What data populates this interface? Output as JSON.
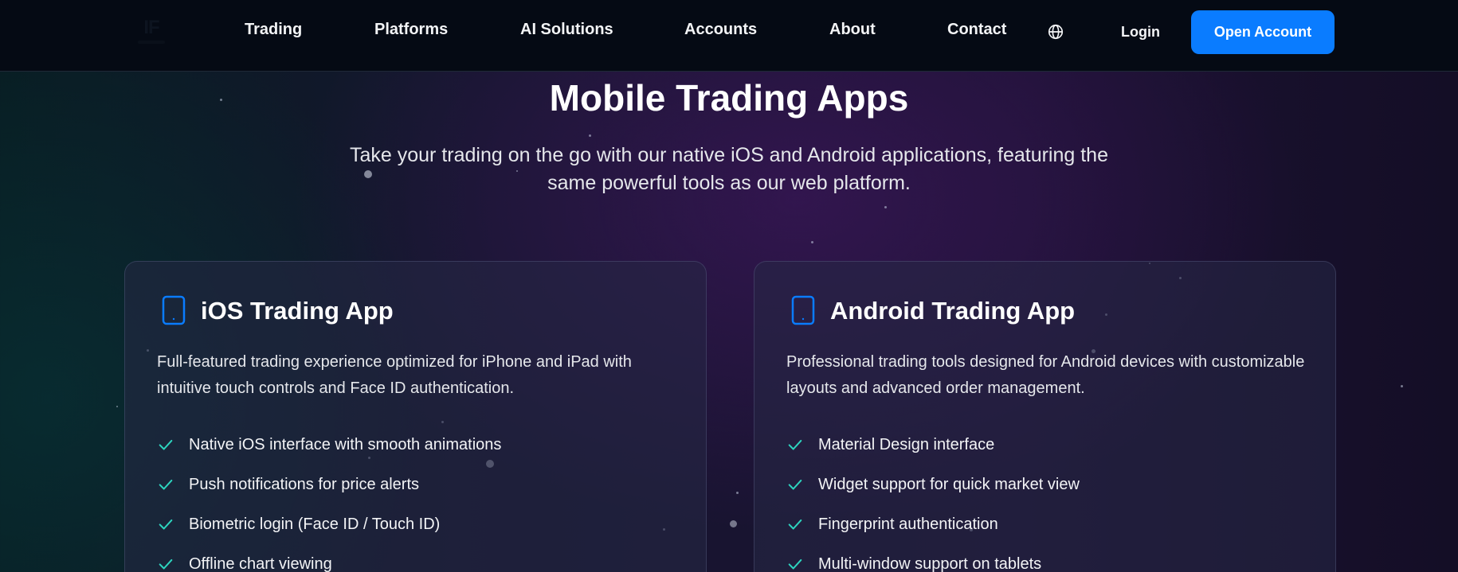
{
  "nav": {
    "logo_text": "IF",
    "links": [
      "Trading",
      "Platforms",
      "AI Solutions",
      "Accounts",
      "About",
      "Contact"
    ],
    "language_icon": "globe-icon",
    "login_label": "Login",
    "cta_label": "Open Account"
  },
  "hero": {
    "title": "Mobile Trading Apps",
    "subtitle": "Take your trading on the go with our native iOS and Android applications, featuring the same powerful tools as our web platform."
  },
  "cards": [
    {
      "icon": "tablet-icon",
      "title": "iOS Trading App",
      "description": "Full-featured trading experience optimized for iPhone and iPad with intuitive touch controls and Face ID authentication.",
      "features": [
        "Native iOS interface with smooth animations",
        "Push notifications for price alerts",
        "Biometric login (Face ID / Touch ID)",
        "Offline chart viewing"
      ]
    },
    {
      "icon": "tablet-icon",
      "title": "Android Trading App",
      "description": "Professional trading tools designed for Android devices with customizable layouts and advanced order management.",
      "features": [
        "Material Design interface",
        "Widget support for quick market view",
        "Fingerprint authentication",
        "Multi-window support on tablets"
      ]
    }
  ],
  "colors": {
    "accent": "#0a7cff",
    "check": "#2dd4bf",
    "nav_background": "#050a14"
  }
}
